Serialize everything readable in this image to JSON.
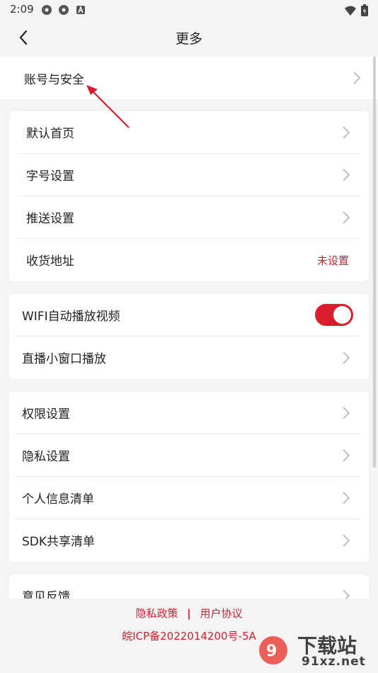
{
  "status_bar": {
    "time": "2:09"
  },
  "header": {
    "title": "更多"
  },
  "groups": [
    {
      "items": [
        {
          "label": "账号与安全",
          "type": "chevron"
        }
      ]
    },
    {
      "items": [
        {
          "label": "默认首页",
          "type": "chevron"
        },
        {
          "label": "字号设置",
          "type": "chevron"
        },
        {
          "label": "推送设置",
          "type": "chevron"
        },
        {
          "label": "收货地址",
          "type": "value",
          "value": "未设置"
        }
      ]
    },
    {
      "items": [
        {
          "label": "WIFI自动播放视频",
          "type": "toggle",
          "on": true
        },
        {
          "label": "直播小窗口播放",
          "type": "chevron"
        }
      ]
    },
    {
      "items": [
        {
          "label": "权限设置",
          "type": "chevron"
        },
        {
          "label": "隐私设置",
          "type": "chevron"
        },
        {
          "label": "个人信息清单",
          "type": "chevron"
        },
        {
          "label": "SDK共享清单",
          "type": "chevron"
        }
      ]
    },
    {
      "items": [
        {
          "label": "意见反馈",
          "type": "chevron"
        }
      ]
    }
  ],
  "footer": {
    "privacy_policy": "隐私政策",
    "separator": "|",
    "user_agreement": "用户协议",
    "icp": "皖ICP备2022014200号-5A"
  },
  "watermark": {
    "text": "下载站",
    "url_text": "91xz.net"
  },
  "colors": {
    "accent": "#d81e2c",
    "background": "#f4f4f4",
    "card": "#ffffff"
  }
}
